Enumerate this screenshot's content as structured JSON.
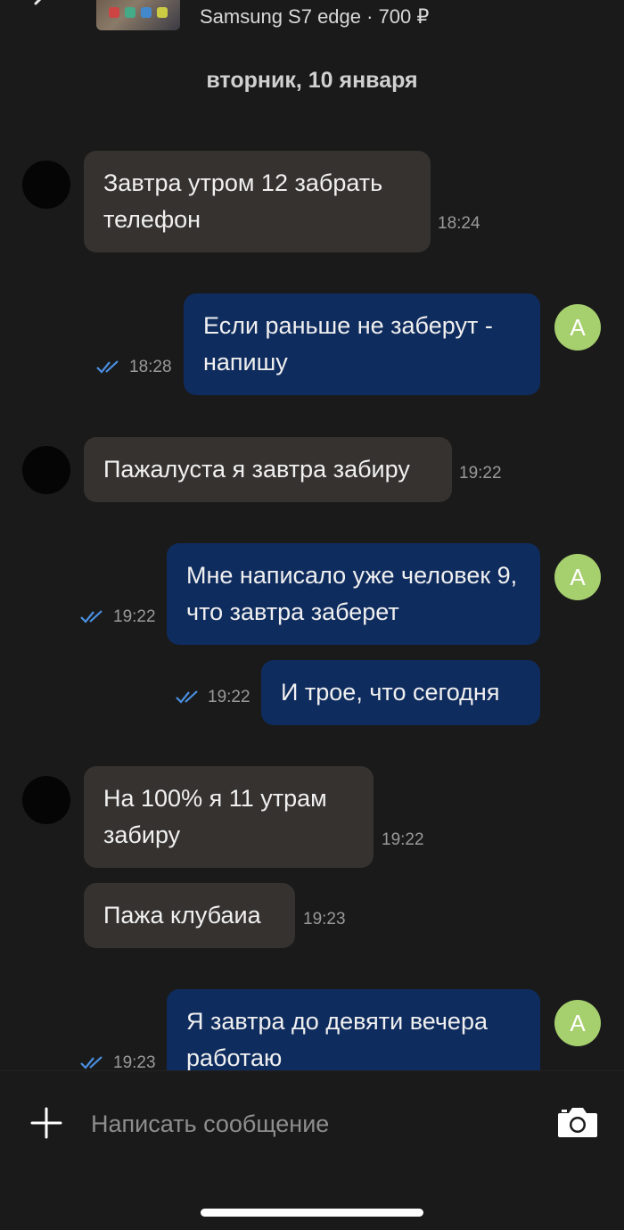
{
  "header": {
    "product_title": "Samsung S7 edge · 700 ₽"
  },
  "date_separator": "вторник, 10 января",
  "messages": [
    {
      "direction": "in",
      "text": "Завтра утром 12 забрать телефон",
      "time": "18:24"
    },
    {
      "direction": "out",
      "text": "Если раньше не заберут - напишу",
      "time": "18:28",
      "status": "read",
      "avatar": "А"
    },
    {
      "direction": "in",
      "text": "Пажалуста я завтра забиру",
      "time": "19:22"
    },
    {
      "direction": "out",
      "text": "Мне написало уже человек 9, что завтра заберет",
      "time": "19:22",
      "status": "read",
      "avatar": "А"
    },
    {
      "direction": "out",
      "text": "И трое, что сегодня",
      "time": "19:22",
      "status": "read"
    },
    {
      "direction": "in",
      "text": "На 100% я 11 утрам забиру",
      "time": "19:22"
    },
    {
      "direction": "in",
      "text": "Пажа клубаиа",
      "time": "19:23"
    },
    {
      "direction": "out",
      "text": "Я завтра до девяти вечера работаю",
      "time": "19:23",
      "status": "read",
      "avatar": "А"
    }
  ],
  "composer": {
    "placeholder": "Написать сообщение"
  },
  "icons": {
    "back": "chevron-left-icon",
    "attach": "plus-icon",
    "camera": "camera-icon",
    "read_status": "double-check-icon"
  },
  "colors": {
    "background": "#1a1a1a",
    "incoming_bubble": "#353230",
    "outgoing_bubble": "#0f2c5e",
    "avatar_out": "#a6cf6e",
    "read_ticks": "#4a90e2"
  }
}
